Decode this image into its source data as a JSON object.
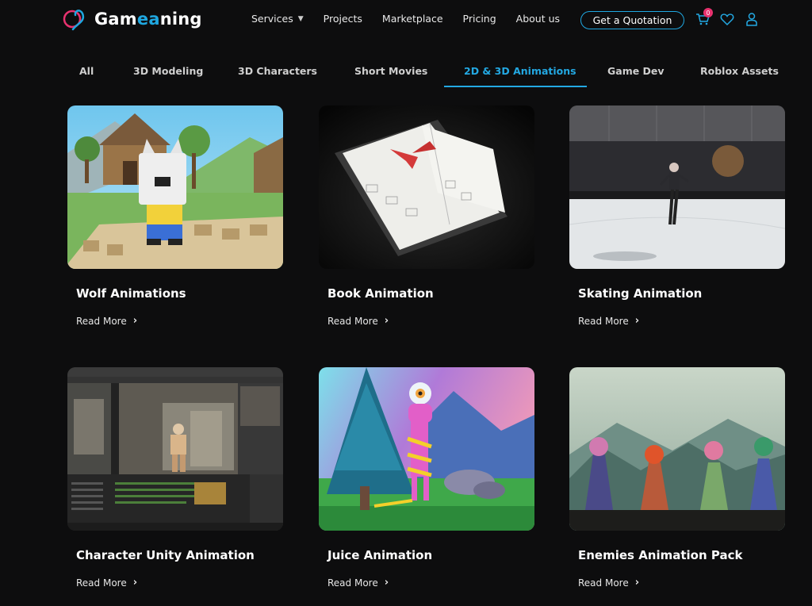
{
  "header": {
    "logo_text_prefix": "Gam",
    "logo_text_accent": "ea",
    "logo_text_suffix": "ning",
    "nav": [
      {
        "label": "Services",
        "has_dropdown": true
      },
      {
        "label": "Projects"
      },
      {
        "label": "Marketplace"
      },
      {
        "label": "Pricing"
      },
      {
        "label": "About us"
      }
    ],
    "cta_label": "Get a Quotation",
    "cart_count": "0",
    "icons": [
      "cart-icon",
      "heart-icon",
      "user-icon"
    ]
  },
  "tabs": [
    {
      "label": "All"
    },
    {
      "label": "3D Modeling"
    },
    {
      "label": "3D Characters"
    },
    {
      "label": "Short Movies"
    },
    {
      "label": "2D & 3D Animations",
      "active": true
    },
    {
      "label": "Game Dev"
    },
    {
      "label": "Roblox Assets"
    }
  ],
  "cards": [
    {
      "title": "Wolf Animations",
      "link": "Read More"
    },
    {
      "title": "Book Animation",
      "link": "Read More"
    },
    {
      "title": "Skating Animation",
      "link": "Read More"
    },
    {
      "title": "Character Unity Animation",
      "link": "Read More"
    },
    {
      "title": "Juice Animation",
      "link": "Read More"
    },
    {
      "title": "Enemies Animation Pack",
      "link": "Read More"
    }
  ],
  "colors": {
    "accent": "#23a8e2",
    "badge": "#e8326f",
    "background": "#0d0d0e"
  }
}
